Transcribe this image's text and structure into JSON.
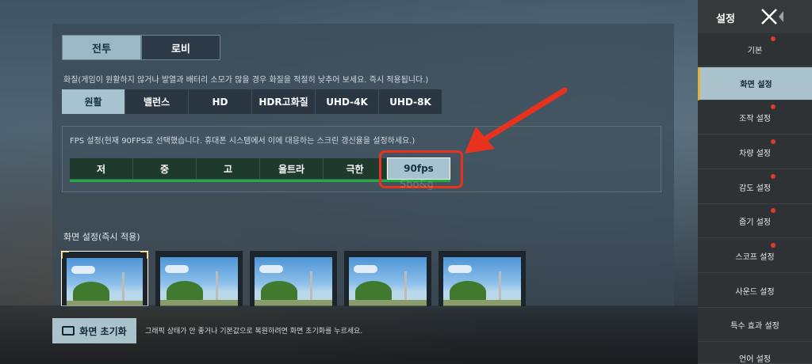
{
  "mode_tabs": [
    {
      "label": "전투",
      "active": true
    },
    {
      "label": "로비",
      "active": false
    }
  ],
  "quality": {
    "description": "화질(게임이 원활하지 않거나 발열과 배터리 소모가 많을 경우 화질을 적절히 낮추어 보세요. 즉시 적용됩니다.)",
    "options": [
      "원활",
      "밸런스",
      "HD",
      "HDR고화질",
      "UHD-4K",
      "UHD-8K"
    ],
    "selected": "원활"
  },
  "fps": {
    "description": "FPS 설정(현재 90FPS로 선택했습니다. 휴대폰 시스템에서 이에 대응하는 스크린 갱신율을 설정하세요.)",
    "options": [
      "저",
      "중",
      "고",
      "울트라",
      "극한",
      "90fps"
    ],
    "selected": "90fps"
  },
  "watermark": "Sbo&g",
  "screen_settings": {
    "title": "화면 설정(즉시 적용)",
    "thumbnail_count": 5,
    "selected_index": 0
  },
  "reset": {
    "label": "화면 초기화",
    "hint": "그래픽 상태가 안 좋거나 기본값으로 복원하려면 화면 초기화를 누르세요."
  },
  "sidebar": {
    "title": "설정",
    "items": [
      {
        "label": "기본",
        "active": false,
        "dot": true
      },
      {
        "label": "화면 설정",
        "active": true,
        "dot": false
      },
      {
        "label": "조작 설정",
        "active": false,
        "dot": true
      },
      {
        "label": "차량 설정",
        "active": false,
        "dot": true
      },
      {
        "label": "감도 설정",
        "active": false,
        "dot": true
      },
      {
        "label": "줍기 설정",
        "active": false,
        "dot": true
      },
      {
        "label": "스코프 설정",
        "active": false,
        "dot": true
      },
      {
        "label": "사운드 설정",
        "active": false,
        "dot": false
      },
      {
        "label": "특수 효과 설정",
        "active": false,
        "dot": false
      },
      {
        "label": "언어 설정",
        "active": false,
        "dot": false
      }
    ]
  },
  "colors": {
    "accent_highlight": "#e8321e",
    "selected_button": "#a6c3cf",
    "fps_bar": "#1fae3c",
    "notification_dot": "#e23a2a"
  },
  "icons": {
    "close": "close-icon",
    "reset": "screen-reset-icon",
    "arrow": "red-arrow-icon"
  }
}
